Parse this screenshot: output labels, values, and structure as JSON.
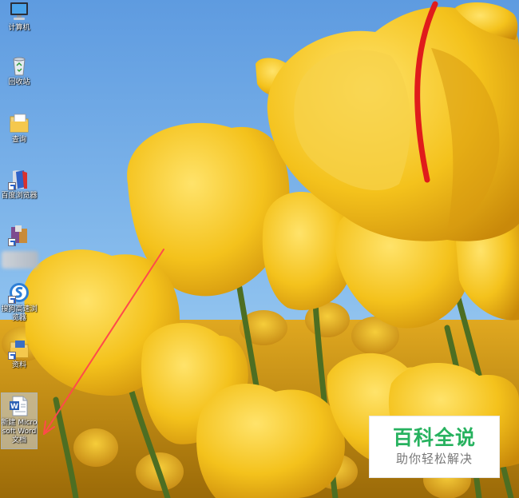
{
  "desktop": {
    "icons": [
      {
        "label": "计算机",
        "icon": "computer-icon"
      },
      {
        "label": "回收站",
        "icon": "recycle-bin-icon"
      },
      {
        "label": "查询",
        "icon": "folder-icon"
      },
      {
        "label": "百度浏览器",
        "icon": "baidu-browser-icon"
      },
      {
        "label": "",
        "icon": "app-shortcut-icon"
      },
      {
        "label": "搜狗高速浏览器",
        "icon": "sogou-browser-icon"
      },
      {
        "label": "资料",
        "icon": "folder-shortcut-icon"
      },
      {
        "label": "新建 Microsoft Word 文档",
        "icon": "word-document-icon"
      }
    ]
  },
  "watermark": {
    "title": "百科全说",
    "subtitle": "助你轻松解决"
  },
  "colors": {
    "sky": "#7fb3e6",
    "tulip": "#f2c21e",
    "stem": "#5a7d2a",
    "annotation_arrow": "#ff4a4a",
    "watermark_green": "#27b25f"
  }
}
